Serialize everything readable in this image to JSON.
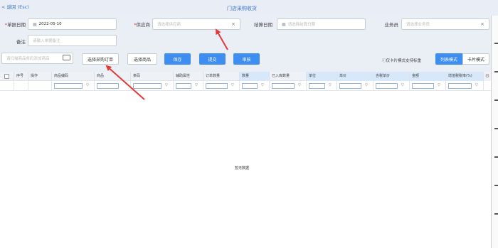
{
  "header": {
    "back_label": "< 返回 (Esc)",
    "title": "门店采购收货"
  },
  "form": {
    "doc_date": {
      "label": "单据日期",
      "required": "*",
      "value": "2022-05-10"
    },
    "supplier": {
      "label": "供应商",
      "required": "*",
      "placeholder": "请选择供应商",
      "clear": "×"
    },
    "settle_date": {
      "label": "结算日期",
      "placeholder": "请选择结算日期"
    },
    "salesman": {
      "label": "业务员",
      "placeholder": "请选择业务员",
      "clear": "×"
    },
    "remark": {
      "label": "备注",
      "placeholder": "请输入单据备注"
    }
  },
  "toolbar": {
    "scan_placeholder": "请扫描商品条码添加商品",
    "select_order": "选择采购订单",
    "select_goods": "选择商品",
    "save": "保存",
    "submit": "提交",
    "audit": "审核",
    "tip": "ⓘ仅卡片模式支持标重",
    "list_mode": "列表模式",
    "card_mode": "卡片模式"
  },
  "table": {
    "columns": [
      "序号",
      "操作",
      "商品编码",
      "商品",
      "条码",
      "辅助属性",
      "订单数量",
      "数量",
      "已入库数量",
      "单位",
      "单价",
      "含税单价",
      "金额",
      "增值税税率(%)"
    ],
    "empty_text": "暂无数据"
  },
  "colors": {
    "primary": "#3d8ef0",
    "link": "#3a73c4",
    "required": "#e23a3a",
    "annotation": "#e53935"
  }
}
